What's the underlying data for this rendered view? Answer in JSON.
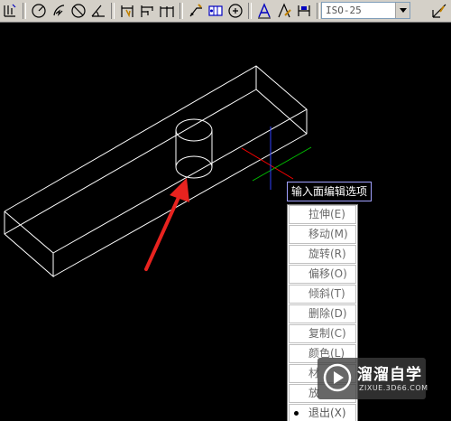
{
  "toolbar": {
    "icons": [
      "ordinate-dimension-icon",
      "radius-dimension-icon",
      "jogged-dimension-icon",
      "diameter-dimension-icon",
      "angular-dimension-icon",
      "quick-dimension-icon",
      "baseline-dimension-icon",
      "continue-dimension-icon",
      "quick-leader-icon",
      "tolerance-icon",
      "center-mark-icon",
      "dimension-edit-icon",
      "dimension-text-edit-icon",
      "dimension-update-icon",
      "dimension-style-icon"
    ],
    "dim_style": "ISO-25"
  },
  "tooltip": "输入面编辑选项",
  "menu": {
    "items": [
      {
        "label": "拉伸(E)"
      },
      {
        "label": "移动(M)"
      },
      {
        "label": "旋转(R)"
      },
      {
        "label": "偏移(O)"
      },
      {
        "label": "倾斜(T)"
      },
      {
        "label": "删除(D)"
      },
      {
        "label": "复制(C)"
      },
      {
        "label": "颜色(L)"
      },
      {
        "label": "材"
      },
      {
        "label": "放"
      },
      {
        "label": "退出(X)",
        "current": true
      }
    ]
  },
  "watermark": {
    "title": "溜溜自学",
    "subtitle": "ZIXUE.3D66.COM"
  },
  "colors": {
    "canvas": "#000000",
    "wireframe": "#ffffff",
    "arrow": "#e8231f",
    "ucs_x": "#ff0000",
    "ucs_y": "#00c000",
    "ucs_z": "#3040ff"
  }
}
